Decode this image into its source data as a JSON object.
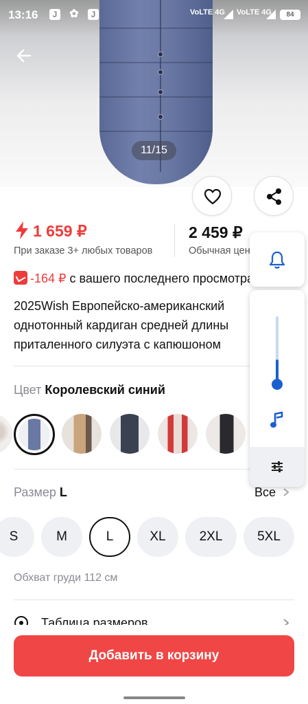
{
  "status_bar": {
    "time": "13:16",
    "net1": "VoLTE 4G",
    "net2": "VoLTE 4G",
    "battery": "84"
  },
  "gallery": {
    "counter": "11/15"
  },
  "icons": {
    "back": "arrow-left-icon",
    "favorite": "heart-icon",
    "share": "share-icon",
    "flash": "lightning-icon",
    "bell": "bell-icon",
    "music": "music-note-icon",
    "settings": "sliders-icon",
    "ruler": "ruler-icon",
    "chevron": "chevron-right-icon"
  },
  "prices": {
    "promo_price": "1 659 ₽",
    "promo_note": "При заказе 3+ любых товаров",
    "regular_price": "2 459 ₽",
    "regular_note": "Обычная цена"
  },
  "price_drop": {
    "amount": "-164 ₽",
    "text": "с вашего последнего просмотра"
  },
  "product": {
    "title_lines": [
      "2025Wish Европейско-американский",
      "однотонный кардиган средней длины",
      "приталенного силуэта с капюшоном"
    ]
  },
  "color": {
    "label": "Цвет",
    "value": "Королевский синий"
  },
  "size": {
    "label": "Размер",
    "value": "L",
    "all_label": "Все",
    "options": [
      "S",
      "M",
      "L",
      "XL",
      "2XL",
      "5XL"
    ],
    "selected": "L",
    "chest_note": "Обхват груди 112 см",
    "table_label": "Таблица размеров"
  },
  "cta": {
    "add_to_cart": "Добавить в корзину"
  },
  "volume_panel": {
    "level": 0.4
  },
  "colors": {
    "accent_red": "#f04646",
    "price_red": "#ee3b3b",
    "volume_blue": "#1a5fd0"
  }
}
